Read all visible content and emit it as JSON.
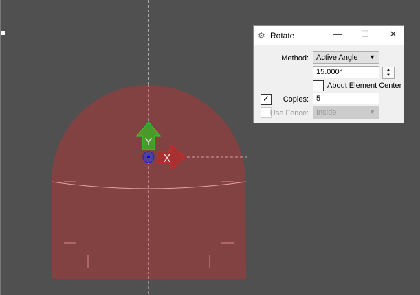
{
  "view": {
    "shape_fill": "#824242",
    "axis_y_label": "Y",
    "axis_x_label": "X"
  },
  "dialog": {
    "title": "Rotate",
    "method_label": "Method:",
    "method_value": "Active Angle",
    "angle_value": "15.000°",
    "about_center_label": "About Element Center",
    "about_center_checked": false,
    "copies_label": "Copies:",
    "copies_checked": true,
    "copies_value": "5",
    "use_fence_label": "Use Fence:",
    "fence_mode_value": "Inside"
  }
}
